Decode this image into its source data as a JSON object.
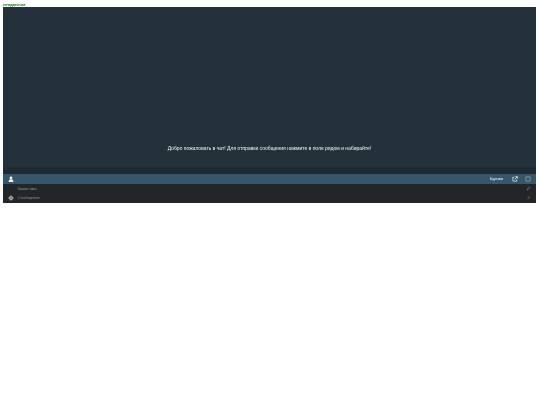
{
  "page": {
    "corner_title": "лендингчат"
  },
  "chat": {
    "welcome_text": "Добро пожаловать в чат! Для отправки сообщения нажмите в поле рядом и набирайте!",
    "toolbar": {
      "brand_label": "Буриви",
      "user_icon": "user-icon",
      "popout_icon": "external-link-icon",
      "expand_icon": "expand-icon"
    },
    "name_field": {
      "placeholder": "Ваше имя"
    },
    "message_field": {
      "placeholder": "Сообщение"
    }
  },
  "colors": {
    "chat_bg": "#22313a",
    "toolbar_bg": "#35566b",
    "input_bg": "#232629",
    "corner_title": "#0a7a0a"
  }
}
